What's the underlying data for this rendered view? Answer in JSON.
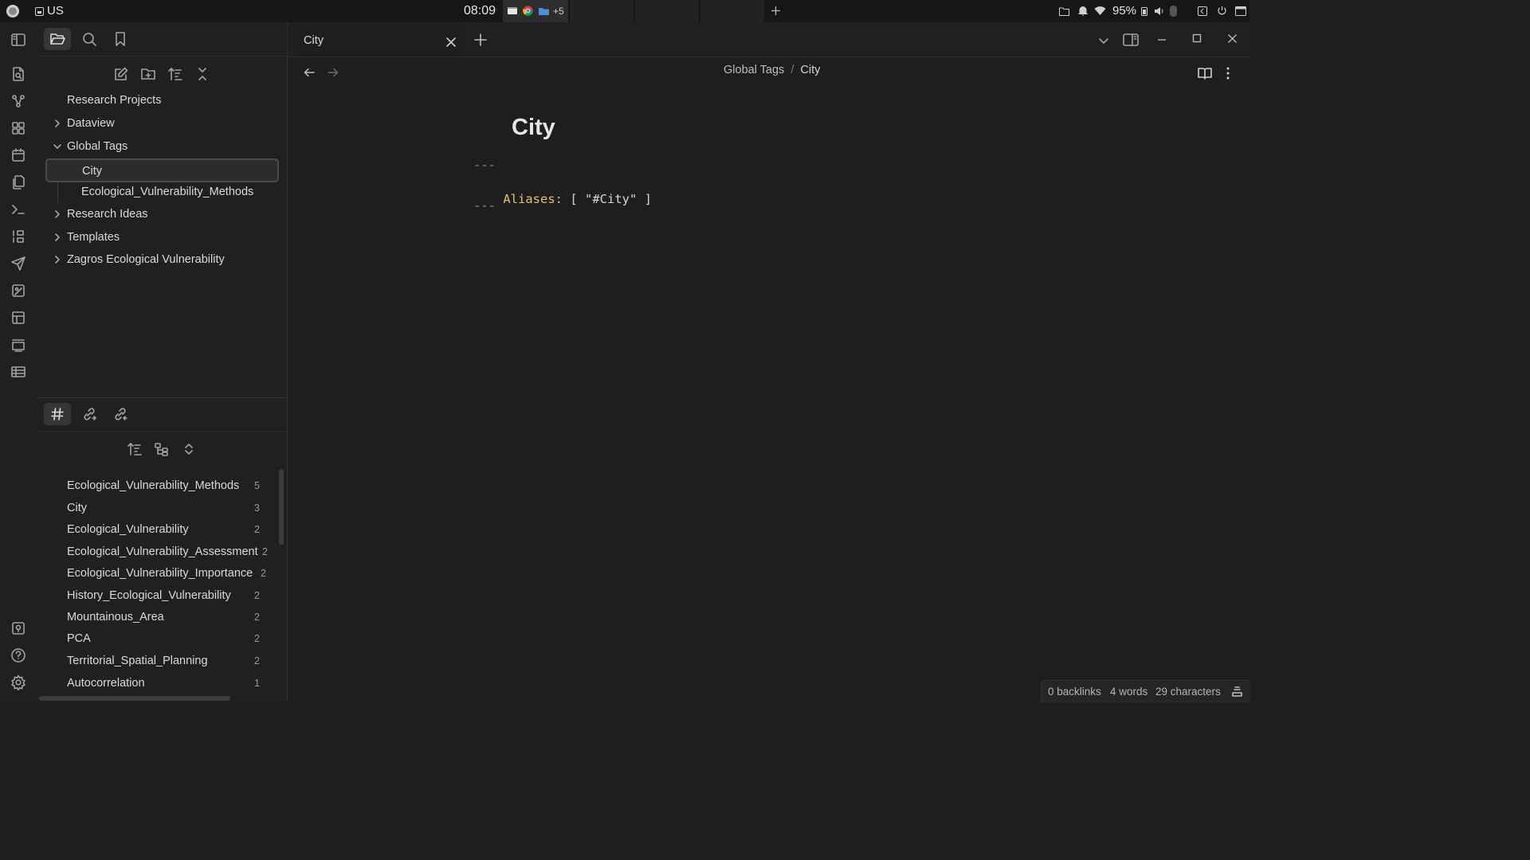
{
  "system_bar": {
    "keyboard_layout": "US",
    "clock": "08:09",
    "dock_overflow": "+5",
    "battery": "95%"
  },
  "tabs": [
    {
      "label": "City"
    }
  ],
  "breadcrumb": {
    "parent": "Global Tags",
    "separator": "/",
    "current": "City"
  },
  "file_tree": [
    {
      "label": "Research Projects",
      "type": "vault-root"
    },
    {
      "label": "Dataview",
      "type": "folder",
      "expanded": false
    },
    {
      "label": "Global Tags",
      "type": "folder",
      "expanded": true
    },
    {
      "label": "City",
      "type": "file",
      "selected": true
    },
    {
      "label": "Ecological_Vulnerability_Methods",
      "type": "file"
    },
    {
      "label": "Research Ideas",
      "type": "folder",
      "expanded": false
    },
    {
      "label": "Templates",
      "type": "folder",
      "expanded": false
    },
    {
      "label": "Zagros Ecological Vulnerability",
      "type": "folder",
      "expanded": false
    }
  ],
  "tags": [
    {
      "name": "Ecological_Vulnerability_Methods",
      "count": "5"
    },
    {
      "name": "City",
      "count": "3"
    },
    {
      "name": "Ecological_Vulnerability",
      "count": "2"
    },
    {
      "name": "Ecological_Vulnerability_Assessment",
      "count": "2"
    },
    {
      "name": "Ecological_Vulnerability_Importance",
      "count": "2"
    },
    {
      "name": "History_Ecological_Vulnerability",
      "count": "2"
    },
    {
      "name": "Mountainous_Area",
      "count": "2"
    },
    {
      "name": "PCA",
      "count": "2"
    },
    {
      "name": "Territorial_Spatial_Planning",
      "count": "2"
    },
    {
      "name": "Autocorrelation",
      "count": "1"
    }
  ],
  "note": {
    "title": "City",
    "frontmatter_open": "---",
    "key": "Aliases",
    "colon": ":",
    "value": "[ \"#City\" ]",
    "frontmatter_close": "---"
  },
  "status_bar": {
    "backlinks": "0 backlinks",
    "words": "4 words",
    "characters": "29 characters"
  },
  "colors": {
    "accent_key": "#e5c07b",
    "background": "#1e1e1e",
    "sidebar": "#202020"
  }
}
